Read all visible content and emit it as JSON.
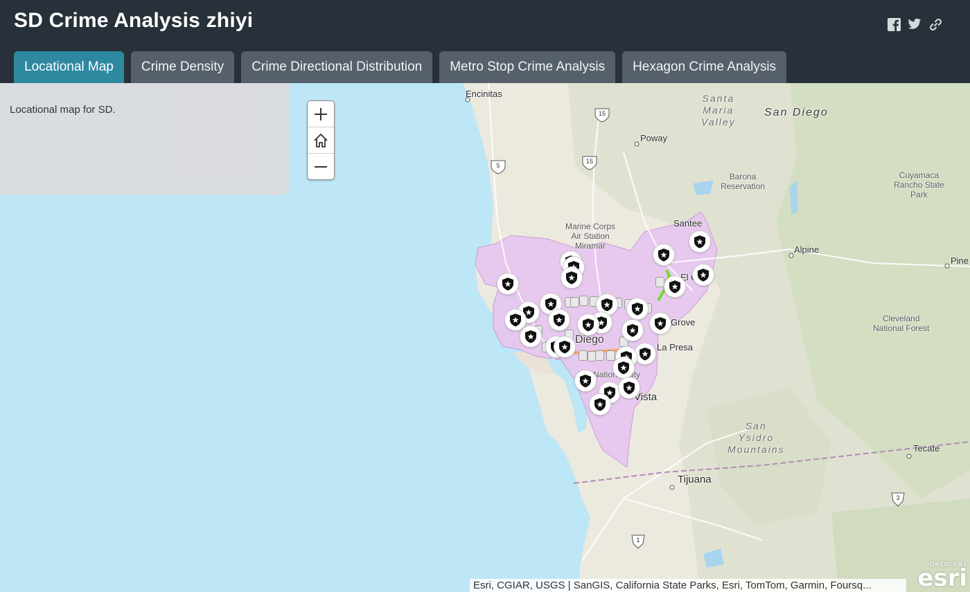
{
  "app": {
    "title": "SD Crime Analysis zhiyi",
    "share_icons": [
      "facebook-icon",
      "twitter-icon",
      "link-icon"
    ]
  },
  "tabs": [
    {
      "label": "Locational Map",
      "active": true
    },
    {
      "label": "Crime Density",
      "active": false
    },
    {
      "label": "Crime Directional Distribution",
      "active": false
    },
    {
      "label": "Metro Stop Crime Analysis",
      "active": false
    },
    {
      "label": "Hexagon Crime Analysis",
      "active": false
    }
  ],
  "side_panel": {
    "text": "Locational map for SD."
  },
  "zoom_controls": [
    "zoom-in-icon",
    "home-icon",
    "zoom-out-icon"
  ],
  "map": {
    "places": {
      "encinitas": "Encinitas",
      "poway": "Poway",
      "santa_maria_valley": "Santa\nMaria\nValley",
      "san_diego_region": "San Diego",
      "barona": "Barona\nReservation",
      "cuyamaca": "Cuyamaca\nRancho State\nPark",
      "santee": "Santee",
      "mcas": "Marine Corps\nAir Station\nMiramar",
      "alpine": "Alpine",
      "pine": "Pine",
      "cleveland": "Cleveland\nNational Forest",
      "lemon_grove": "Grove",
      "san_diego_city": "Diego",
      "la_presa": "La Presa",
      "national_city": "National City",
      "chula_vista": "Vista",
      "el_cajon": "El C",
      "san_ysidro": "San\nYsidro\nMountains",
      "tecate": "Tecate",
      "tijuana": "Tijuana"
    },
    "highway_shields": [
      "15",
      "5",
      "15",
      "3",
      "1"
    ],
    "attribution": "Esri, CGIAR, USGS | SanGIS, California State Parks, Esri, TomTom, Garmin, Foursq...",
    "logo": {
      "powered": "POWERED BY",
      "name": "esri"
    },
    "colors": {
      "water": "#bde6f7",
      "land": "#e9e6dc",
      "terrain": "#d9dcc9",
      "forest": "#c8d9b5",
      "crime_area": "#e6c4f0",
      "marker": "#ffffff"
    }
  }
}
